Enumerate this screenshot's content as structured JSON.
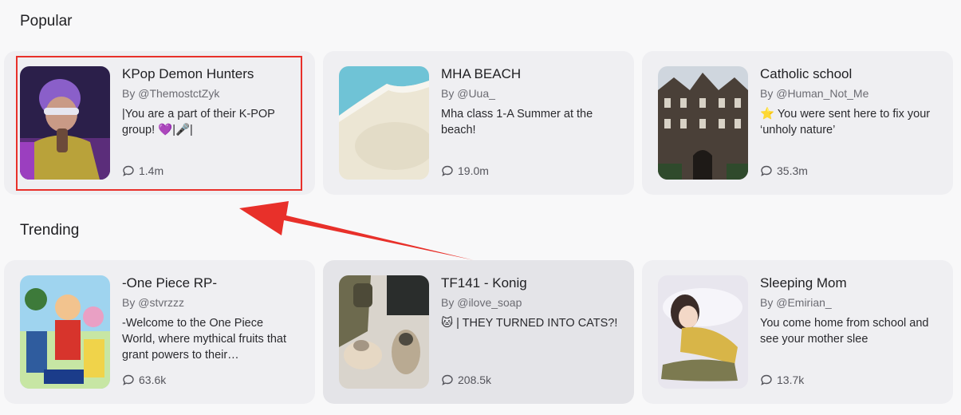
{
  "sections": {
    "popular_title": "Popular",
    "trending_title": "Trending"
  },
  "popular": [
    {
      "title": "KPop Demon Hunters",
      "author": "By @ThemostctZyk",
      "desc": "|You are a part of their K-POP group! 💜|🎤|",
      "chats": "1.4m"
    },
    {
      "title": "MHA BEACH",
      "author": "By @Uua_",
      "desc": "Mha class 1-A Summer at the beach!",
      "chats": "19.0m"
    },
    {
      "title": "Catholic school",
      "author": "By @Human_Not_Me",
      "desc": "⭐ You were sent here to fix your ‘unholy nature’",
      "chats": "35.3m"
    }
  ],
  "trending": [
    {
      "title": "-One Piece RP-",
      "author": "By @stvrzzz",
      "desc": "-Welcome to the One Piece World, where mythical fruits that grant powers to their…",
      "chats": "63.6k"
    },
    {
      "title": "TF141 - Konig",
      "author": "By @ilove_soap",
      "desc": "🐱 | THEY TURNED INTO CATS?!",
      "chats": "208.5k"
    },
    {
      "title": "Sleeping Mom",
      "author": "By @Emirian_",
      "desc": "You come home from school and see your mother slee",
      "chats": "13.7k"
    }
  ],
  "colors": {
    "card_bg": "#efeff2",
    "card_hover_bg": "#e4e4e8",
    "annotation_red": "#e8302a"
  }
}
